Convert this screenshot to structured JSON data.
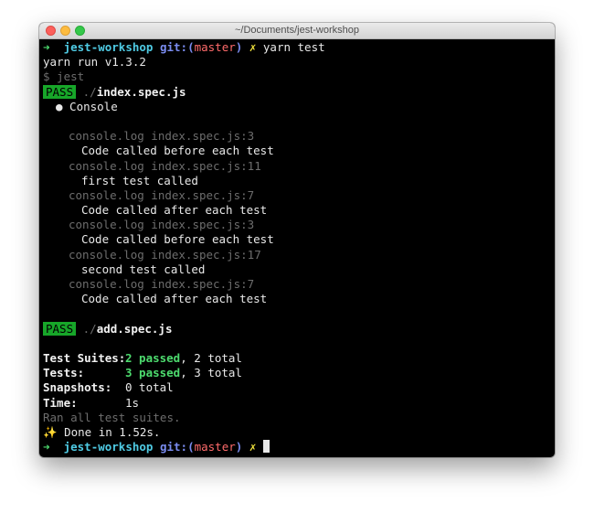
{
  "window": {
    "title": "~/Documents/jest-workshop"
  },
  "prompt": {
    "arrow": "➜",
    "dir": "jest-workshop",
    "git_label": "git:(",
    "branch": "master",
    "git_close": ")",
    "dirty": "✗"
  },
  "commands": {
    "first": "yarn test"
  },
  "output": {
    "yarn_version": "yarn run v1.3.2",
    "jest_cmd": "$ jest",
    "pass_label": "PASS",
    "spec1_dir": "./",
    "spec1_file": "index.spec.js",
    "console_header": "● Console",
    "logs": [
      {
        "src": "console.log index.spec.js:3",
        "msg": "Code called before each test"
      },
      {
        "src": "console.log index.spec.js:11",
        "msg": "first test called"
      },
      {
        "src": "console.log index.spec.js:7",
        "msg": "Code called after each test"
      },
      {
        "src": "console.log index.spec.js:3",
        "msg": "Code called before each test"
      },
      {
        "src": "console.log index.spec.js:17",
        "msg": "second test called"
      },
      {
        "src": "console.log index.spec.js:7",
        "msg": "Code called after each test"
      }
    ],
    "spec2_dir": "./",
    "spec2_file": "add.spec.js",
    "summary": {
      "suites_label": "Test Suites:",
      "suites_passed": "2 passed",
      "suites_total": ", 2 total",
      "tests_label": "Tests:",
      "tests_passed": "3 passed",
      "tests_total": ", 3 total",
      "snapshots_label": "Snapshots:",
      "snapshots_value": "0 total",
      "time_label": "Time:",
      "time_value": "1s"
    },
    "ran_all": "Ran all test suites.",
    "done": "✨ Done in 1.52s."
  }
}
